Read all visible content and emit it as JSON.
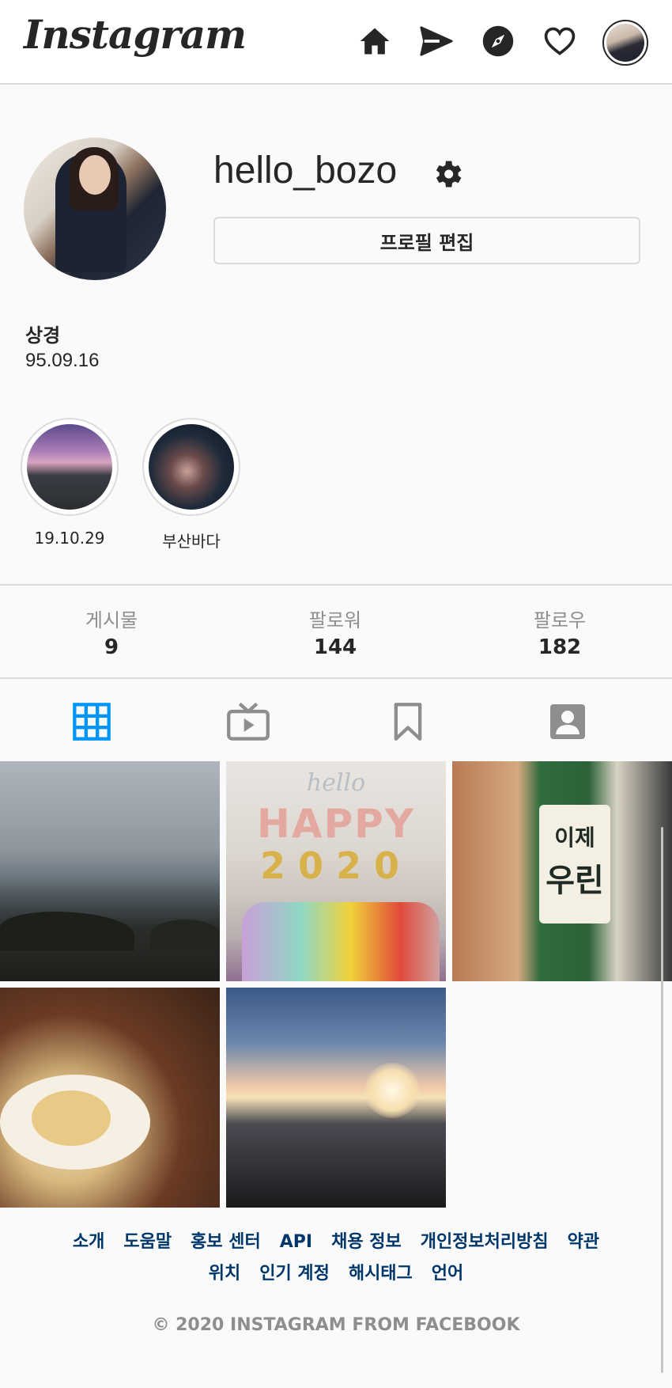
{
  "app": {
    "logo_text": "Instagram"
  },
  "nav": {
    "icons": [
      "home-icon",
      "direct-icon",
      "explore-icon",
      "activity-icon"
    ]
  },
  "profile": {
    "username": "hello_bozo",
    "edit_label": "프로필 편집",
    "bio_name": "상경",
    "bio_text": "95.09.16"
  },
  "highlights": [
    {
      "label": "19.10.29"
    },
    {
      "label": "부산바다"
    }
  ],
  "stats": {
    "posts_label": "게시물",
    "posts_value": "9",
    "followers_label": "팔로워",
    "followers_value": "144",
    "following_label": "팔로우",
    "following_value": "182"
  },
  "tabs": [
    "posts-grid",
    "igtv",
    "saved",
    "tagged"
  ],
  "active_tab": "posts-grid",
  "colors": {
    "accent": "#0095f6",
    "link": "#00376b",
    "muted": "#8e8e8e",
    "border": "#dbdbdb"
  },
  "tiles": {
    "t2_text_top": "HAPPY",
    "t2_text_bottom": "2020",
    "t2_script": "hello",
    "t3_label_top": "이제",
    "t3_label_bottom": "우린"
  },
  "footer": {
    "row1": [
      "소개",
      "도움말",
      "홍보 센터",
      "API",
      "채용 정보",
      "개인정보처리방침",
      "약관"
    ],
    "row2": [
      "위치",
      "인기 계정",
      "해시태그",
      "언어"
    ],
    "copyright": "© 2020 INSTAGRAM FROM FACEBOOK"
  }
}
